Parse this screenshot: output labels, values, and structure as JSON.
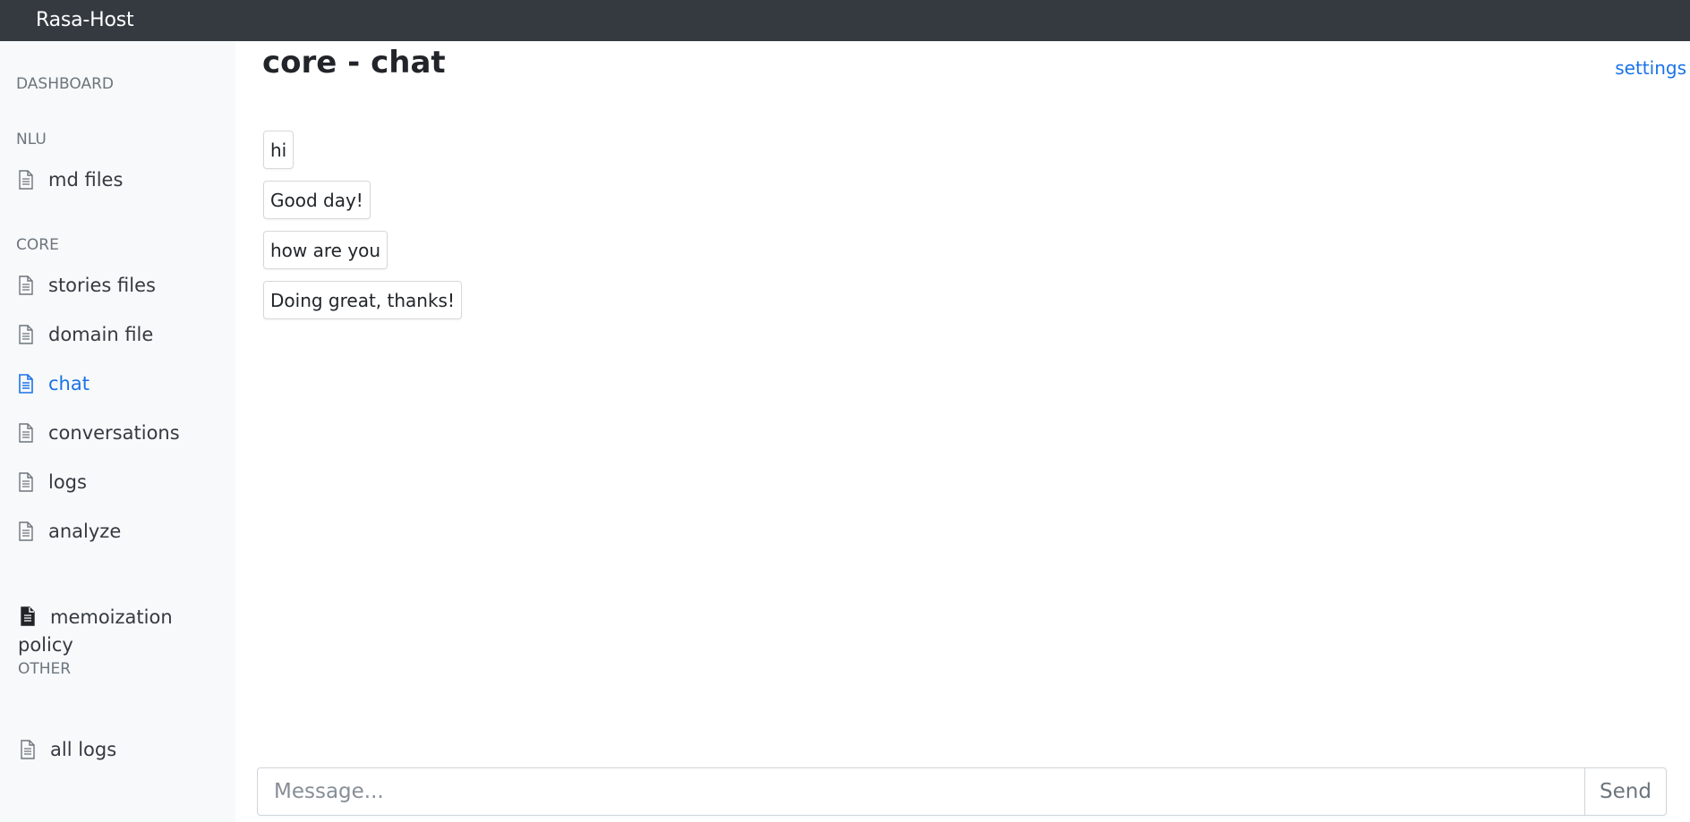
{
  "app": {
    "brand": "Rasa-Host"
  },
  "sidebar": {
    "dashboard_label": "DASHBOARD",
    "sections": {
      "nlu": "NLU",
      "core": "CORE",
      "other": "OTHER"
    },
    "items": {
      "md_files": "md files",
      "stories_files": "stories files",
      "domain_file": "domain file",
      "chat": "chat",
      "conversations": "conversations",
      "logs": "logs",
      "analyze": "analyze",
      "memoization_policy": "memoization policy",
      "all_logs": "all logs"
    },
    "icon": "file-text-icon",
    "active_color": "#1a73e8"
  },
  "main": {
    "title": "core - chat",
    "settings_link": "settings",
    "messages": [
      "hi",
      "Good day!",
      "how are you",
      "Doing great, thanks!"
    ]
  },
  "composer": {
    "placeholder": "Message...",
    "send_label": "Send"
  }
}
